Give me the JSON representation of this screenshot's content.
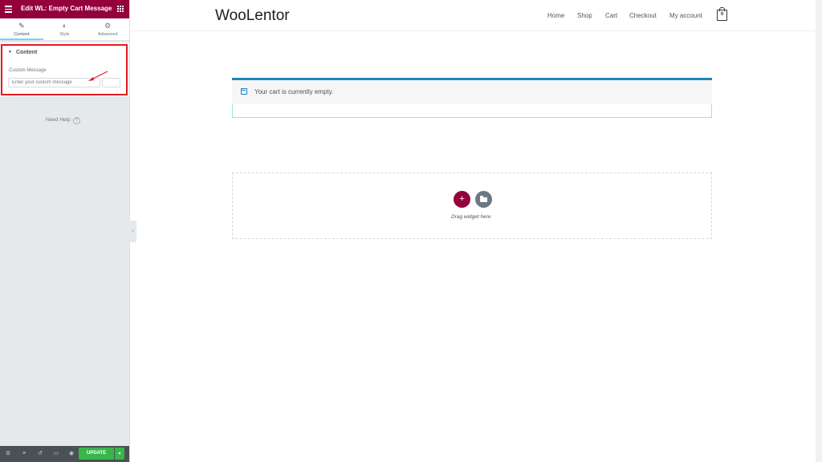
{
  "sidebar": {
    "header_title": "Edit WL: Empty Cart Message",
    "tabs": [
      {
        "label": "Content",
        "icon": "pencil-icon",
        "active": true
      },
      {
        "label": "Style",
        "icon": "half-circle-icon",
        "active": false
      },
      {
        "label": "Advanced",
        "icon": "gear-icon",
        "active": false
      }
    ],
    "section_title": "Content",
    "field_label": "Custom Message",
    "field_placeholder": "Enter your custom message",
    "need_help": "Need Help",
    "update_label": "UPDATE",
    "footer_icons": [
      "settings-icon",
      "layers-icon",
      "history-icon",
      "responsive-icon",
      "eye-icon"
    ]
  },
  "site": {
    "title": "WooLentor",
    "nav": [
      "Home",
      "Shop",
      "Cart",
      "Checkout",
      "My account"
    ],
    "cart_count": "0"
  },
  "content": {
    "notice_text": "Your cart is currently empty.",
    "drag_text": "Drag widget here"
  },
  "colors": {
    "brand": "#93003c",
    "update": "#39b54a",
    "notice_accent": "#1e85be",
    "highlight": "#e4191f"
  }
}
